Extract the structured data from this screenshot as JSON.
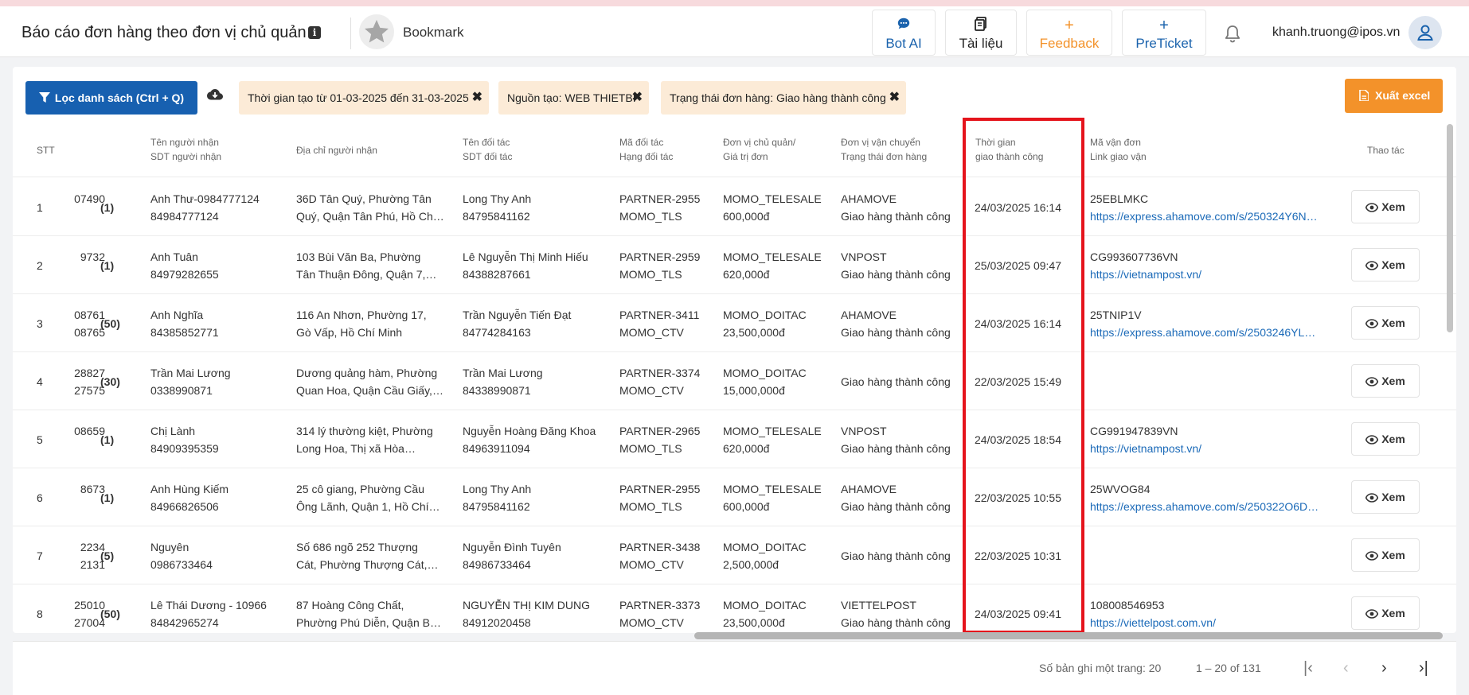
{
  "header": {
    "title": "Báo cáo đơn hàng theo đơn vị chủ quản",
    "info_icon": "i",
    "bookmark_label": "Bookmark",
    "buttons": {
      "bot_ai": {
        "glyph": "💬",
        "label": "Bot AI"
      },
      "docs": {
        "glyph": "▤",
        "label": "Tài liệu"
      },
      "feedback": {
        "glyph": "+",
        "label": "Feedback"
      },
      "preticket": {
        "glyph": "+",
        "label": "PreTicket"
      }
    },
    "user_email": "khanh.truong@ipos.vn"
  },
  "toolbar": {
    "filter_label": "Lọc danh sách (Ctrl + Q)",
    "chips": [
      {
        "label": "Thời gian tạo từ 01-03-2025 đến 31-03-2025",
        "remove": "✖"
      },
      {
        "label": "Nguồn tạo: WEB THIETBI",
        "remove": "✖"
      },
      {
        "label": "Trạng thái đơn hàng: Giao hàng thành công",
        "remove": "✖"
      }
    ],
    "export_label": "Xuất excel"
  },
  "columns": {
    "stt": "STT",
    "recv1": "Tên người nhận",
    "recv2": "SDT người nhận",
    "addr": "Địa chỉ người nhận",
    "part1": "Tên đối tác",
    "part2": "SDT đối tác",
    "pcode1": "Mã đối tác",
    "pcode2": "Hạng đối tác",
    "unit1": "Đơn vị chủ quản/",
    "unit2": "Giá trị đơn",
    "ship1": "Đơn vị vận chuyển",
    "ship2": "Trạng thái đơn hàng",
    "time1": "Thời gian",
    "time2": "giao thành công",
    "track1": "Mã vận đơn",
    "track2": "Link giao vận",
    "action": "Thao tác"
  },
  "view_label": "Xem",
  "rows": [
    {
      "stt": "1",
      "code1": "07490",
      "code2": "",
      "count": "(1)",
      "recv_name": "Anh Thư-0984777124",
      "recv_phone": "84984777124",
      "addr1": "36D Tân Quý, Phường Tân",
      "addr2": "Quý, Quận Tân Phú, Hồ Chí…",
      "partner_name": "Long Thy Anh",
      "partner_phone": "84795841162",
      "partner_code": "PARTNER-2955",
      "partner_rank": "MOMO_TLS",
      "unit": "MOMO_TELESALE",
      "value": "600,000đ",
      "carrier": "AHAMOVE",
      "status": "Giao hàng thành công",
      "time": "24/03/2025 16:14",
      "tracking": "25EBLMKC",
      "link": "https://express.ahamove.com/s/250324Y6N…"
    },
    {
      "stt": "2",
      "code1": "9732",
      "code2": "",
      "count": "(1)",
      "recv_name": "Anh Tuân",
      "recv_phone": "84979282655",
      "addr1": "103 Bùi Văn Ba, Phường",
      "addr2": "Tân Thuận Đông, Quận 7,…",
      "partner_name": "Lê Nguyễn Thị Minh Hiếu",
      "partner_phone": "84388287661",
      "partner_code": "PARTNER-2959",
      "partner_rank": "MOMO_TLS",
      "unit": "MOMO_TELESALE",
      "value": "620,000đ",
      "carrier": "VNPOST",
      "status": "Giao hàng thành công",
      "time": "25/03/2025 09:47",
      "tracking": "CG993607736VN",
      "link": "https://vietnampost.vn/"
    },
    {
      "stt": "3",
      "code1": "08761",
      "code2": "08765",
      "count": "(50)",
      "recv_name": "Anh Nghĩa",
      "recv_phone": "84385852771",
      "addr1": "116 An Nhơn, Phường 17,",
      "addr2": "Gò Vấp, Hồ Chí Minh",
      "partner_name": "Trần Nguyễn Tiến Đạt",
      "partner_phone": "84774284163",
      "partner_code": "PARTNER-3411",
      "partner_rank": "MOMO_CTV",
      "unit": "MOMO_DOITAC",
      "value": "23,500,000đ",
      "carrier": "AHAMOVE",
      "status": "Giao hàng thành công",
      "time": "24/03/2025 16:14",
      "tracking": "25TNIP1V",
      "link": "https://express.ahamove.com/s/2503246YL…"
    },
    {
      "stt": "4",
      "code1": "28827",
      "code2": "27575",
      "count": "(30)",
      "recv_name": "Trần Mai Lương",
      "recv_phone": "0338990871",
      "addr1": "Dương quảng hàm, Phường",
      "addr2": "Quan Hoa, Quận Cầu Giấy,…",
      "partner_name": "Trần Mai Lương",
      "partner_phone": "84338990871",
      "partner_code": "PARTNER-3374",
      "partner_rank": "MOMO_CTV",
      "unit": "MOMO_DOITAC",
      "value": "15,000,000đ",
      "carrier": "",
      "status": "Giao hàng thành công",
      "time": "22/03/2025 15:49",
      "tracking": "",
      "link": ""
    },
    {
      "stt": "5",
      "code1": "08659",
      "code2": "",
      "count": "(1)",
      "recv_name": "Chị Lành",
      "recv_phone": "84909395359",
      "addr1": "314 lý thường kiệt, Phường",
      "addr2": "Long Hoa, Thị xã Hòa…",
      "partner_name": "Nguyễn Hoàng Đăng Khoa",
      "partner_phone": "84963911094",
      "partner_code": "PARTNER-2965",
      "partner_rank": "MOMO_TLS",
      "unit": "MOMO_TELESALE",
      "value": "620,000đ",
      "carrier": "VNPOST",
      "status": "Giao hàng thành công",
      "time": "24/03/2025 18:54",
      "tracking": "CG991947839VN",
      "link": "https://vietnampost.vn/"
    },
    {
      "stt": "6",
      "code1": "8673",
      "code2": "",
      "count": "(1)",
      "recv_name": "Anh Hùng Kiếm",
      "recv_phone": "84966826506",
      "addr1": "25 cô giang, Phường Cầu",
      "addr2": "Ông Lãnh, Quận 1, Hồ Chí…",
      "partner_name": "Long Thy Anh",
      "partner_phone": "84795841162",
      "partner_code": "PARTNER-2955",
      "partner_rank": "MOMO_TLS",
      "unit": "MOMO_TELESALE",
      "value": "600,000đ",
      "carrier": "AHAMOVE",
      "status": "Giao hàng thành công",
      "time": "22/03/2025 10:55",
      "tracking": "25WVOG84",
      "link": "https://express.ahamove.com/s/250322O6D…"
    },
    {
      "stt": "7",
      "code1": "2234",
      "code2": "2131",
      "count": "(5)",
      "recv_name": "Nguyên",
      "recv_phone": "0986733464",
      "addr1": "Số 686 ngõ 252 Thượng",
      "addr2": "Cát, Phường Thượng Cát,…",
      "partner_name": "Nguyễn Đình Tuyên",
      "partner_phone": "84986733464",
      "partner_code": "PARTNER-3438",
      "partner_rank": "MOMO_CTV",
      "unit": "MOMO_DOITAC",
      "value": "2,500,000đ",
      "carrier": "",
      "status": "Giao hàng thành công",
      "time": "22/03/2025 10:31",
      "tracking": "",
      "link": ""
    },
    {
      "stt": "8",
      "code1": "25010",
      "code2": "27004",
      "count": "(50)",
      "recv_name": "Lê Thái Dương - 10966",
      "recv_phone": "84842965274",
      "addr1": "87 Hoàng Công Chất,",
      "addr2": "Phường Phú Diễn, Quận B…",
      "partner_name": "NGUYỄN THỊ KIM DUNG",
      "partner_phone": "84912020458",
      "partner_code": "PARTNER-3373",
      "partner_rank": "MOMO_CTV",
      "unit": "MOMO_DOITAC",
      "value": "23,500,000đ",
      "carrier": "VIETTELPOST",
      "status": "Giao hàng thành công",
      "time": "24/03/2025 09:41",
      "tracking": "108008546953",
      "link": "https://viettelpost.com.vn/"
    }
  ],
  "pagination": {
    "per_page": "Số bản ghi một trang: 20",
    "range": "1 – 20 of 131",
    "first": "|‹",
    "prev": "‹",
    "next": "›",
    "last": "›|"
  },
  "colors": {
    "primary": "#1760b0",
    "accent": "#f3922a",
    "chip_bg": "#fcebd7",
    "highlight": "#e5141c",
    "link": "#1b6ab8"
  }
}
